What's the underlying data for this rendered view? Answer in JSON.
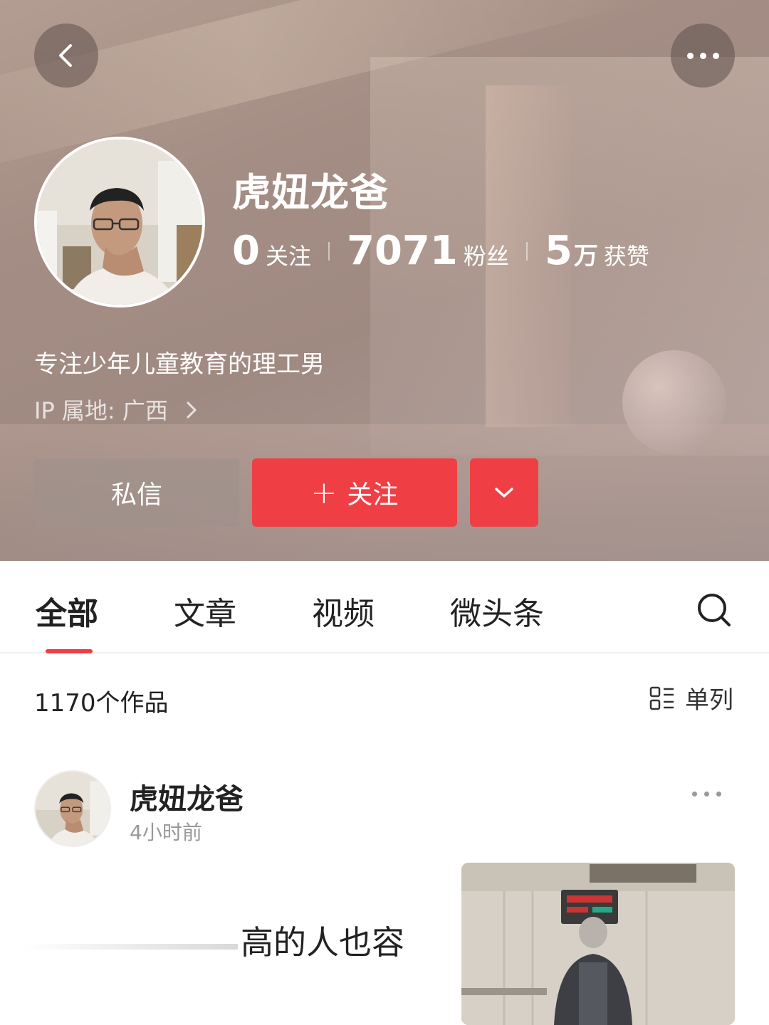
{
  "profile": {
    "username": "虎妞龙爸",
    "stats": [
      {
        "num": "0",
        "unit": "",
        "label": "关注"
      },
      {
        "num": "7071",
        "unit": "",
        "label": "粉丝"
      },
      {
        "num": "5",
        "unit": "万",
        "label": "获赞"
      }
    ],
    "bio": "专注少年儿童教育的理工男",
    "ip": "IP 属地: 广西"
  },
  "actions": {
    "message": "私信",
    "follow_plus": "+",
    "follow": "关注"
  },
  "tabs": [
    "全部",
    "文章",
    "视频",
    "微头条"
  ],
  "works": {
    "count": "1170个作品",
    "view_mode": "单列"
  },
  "post": {
    "author": "虎妞龙爸",
    "time": "4小时前",
    "text": "高的人也容"
  },
  "colors": {
    "accent": "#ef3f44"
  },
  "icons": [
    "back-arrow-icon",
    "more-dots-icon",
    "chevron-right-icon",
    "chevron-down-icon",
    "search-icon",
    "list-view-icon"
  ]
}
